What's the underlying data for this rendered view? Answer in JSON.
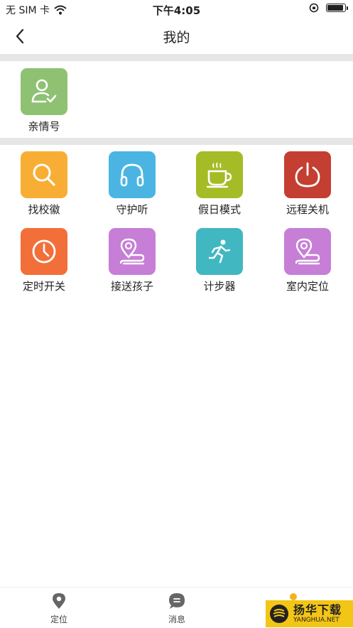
{
  "status": {
    "carrier": "无 SIM 卡",
    "time": "下午4:05",
    "battery_level": 0.95
  },
  "nav": {
    "title": "我的"
  },
  "family": {
    "label": "亲情号",
    "color": "#8fc173",
    "icon": "user-check-icon"
  },
  "features": [
    {
      "label": "找校徽",
      "color": "#f8ae35",
      "icon": "search-icon"
    },
    {
      "label": "守护听",
      "color": "#4ab5e3",
      "icon": "headphones-icon"
    },
    {
      "label": "假日模式",
      "color": "#a5bc26",
      "icon": "coffee-cup-icon"
    },
    {
      "label": "远程关机",
      "color": "#c43f31",
      "icon": "power-icon"
    },
    {
      "label": "定时开关",
      "color": "#f36f3a",
      "icon": "clock-icon"
    },
    {
      "label": "接送孩子",
      "color": "#c77ed6",
      "icon": "route-pin-icon"
    },
    {
      "label": "计步器",
      "color": "#41b7c1",
      "icon": "runner-icon"
    },
    {
      "label": "室内定位",
      "color": "#c77ed6",
      "icon": "route-pin-icon"
    }
  ],
  "tabs": [
    {
      "label": "定位",
      "icon": "location-pin-icon"
    },
    {
      "label": "消息",
      "icon": "chat-bubble-icon"
    },
    {
      "label": "",
      "icon": "profile-icon"
    }
  ],
  "tab_colors": {
    "inactive": "#666666",
    "active": "#f3b21c"
  },
  "watermark": {
    "cn": "扬华下载",
    "en": "YANGHUA.NET"
  }
}
